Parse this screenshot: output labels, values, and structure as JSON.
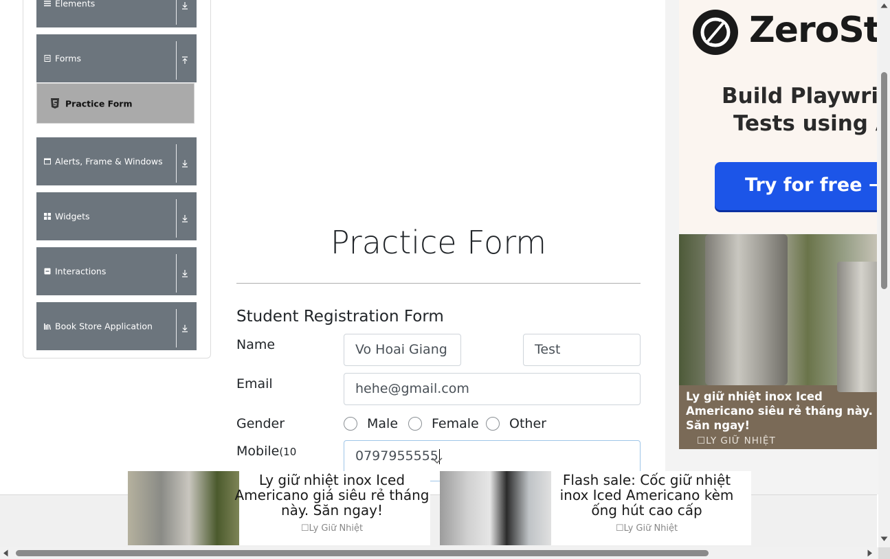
{
  "sidebar": {
    "groups": [
      {
        "label": "Elements",
        "icon": "list-icon",
        "arrow": "down"
      },
      {
        "label": "Forms",
        "icon": "form-icon",
        "arrow": "up"
      },
      {
        "label": "Alerts, Frame & Windows",
        "icon": "window-icon",
        "arrow": "down"
      },
      {
        "label": "Widgets",
        "icon": "grid-icon",
        "arrow": "down"
      },
      {
        "label": "Interactions",
        "icon": "interaction-icon",
        "arrow": "down"
      },
      {
        "label": "Book Store Application",
        "icon": "books-icon",
        "arrow": "down"
      }
    ],
    "active_item": {
      "label": "Practice Form",
      "icon": "html5-icon"
    }
  },
  "main": {
    "title": "Practice Form",
    "form_heading": "Student Registration Form",
    "name_label": "Name",
    "first_name_value": "Vo Hoai Giang",
    "last_name_value": "Test",
    "email_label": "Email",
    "email_value": "hehe@gmail.com",
    "gender_label": "Gender",
    "gender_options": [
      "Male",
      "Female",
      "Other"
    ],
    "mobile_label": "Mobile",
    "mobile_hint": "(10",
    "mobile_value": "0797955555"
  },
  "ads": {
    "right_top": {
      "brand": "ZeroSte",
      "tagline_line1": "Build Playwrigh",
      "tagline_line2": "Tests using A",
      "cta": "Try for free →"
    },
    "right_bottom": {
      "caption": "Ly giữ nhiệt inox Iced Americano siêu rẻ tháng này. Săn ngay!",
      "cta": "☐LY GIỮ NHIỆT"
    },
    "bottom_1": {
      "text": "Ly giữ nhiệt inox Iced Americano giá siêu rẻ tháng này. Săn ngay!",
      "brand": "☐Ly Giữ Nhiệt"
    },
    "bottom_2": {
      "text": "Flash sale: Cốc giữ nhiệt inox Iced Americano kèm ống hút cao cấp",
      "brand": "☐Ly Giữ Nhiệt"
    }
  },
  "colors": {
    "sidebar_bg": "#6c757d",
    "active_item_bg": "#aaaaaa",
    "cta_blue": "#1c55e8"
  }
}
